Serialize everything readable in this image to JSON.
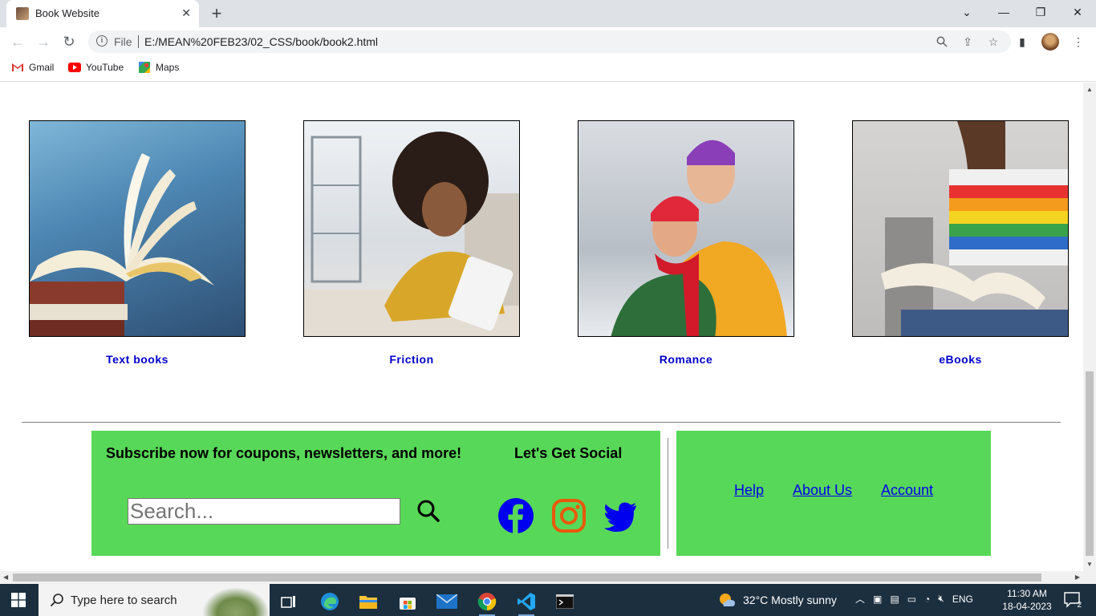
{
  "browser": {
    "tab_title": "Book Website",
    "file_label": "File",
    "url": "E:/MEAN%20FEB23/02_CSS/book/book2.html",
    "bookmarks": [
      {
        "label": "Gmail",
        "icon": "gmail-icon"
      },
      {
        "label": "YouTube",
        "icon": "youtube-icon"
      },
      {
        "label": "Maps",
        "icon": "maps-icon"
      }
    ]
  },
  "categories": [
    {
      "label": "Text books"
    },
    {
      "label": "Friction"
    },
    {
      "label": "Romance"
    },
    {
      "label": "eBooks"
    }
  ],
  "footer": {
    "subscribe_text": "Subscribe now for coupons, newsletters, and more!",
    "social_title": "Let's Get Social",
    "search_placeholder": "Search...",
    "social_icons": [
      "facebook-icon",
      "instagram-icon",
      "twitter-icon"
    ],
    "links": [
      {
        "label": "Help"
      },
      {
        "label": "About Us"
      },
      {
        "label": "Account"
      }
    ]
  },
  "taskbar": {
    "search_placeholder": "Type here to search",
    "weather": "32°C  Mostly sunny",
    "language": "ENG",
    "time": "11:30 AM",
    "date": "18-04-2023",
    "notification_count": "2"
  },
  "colors": {
    "footer_bg": "#58d858",
    "category_label": "#0000cd",
    "link": "#0000ee"
  }
}
